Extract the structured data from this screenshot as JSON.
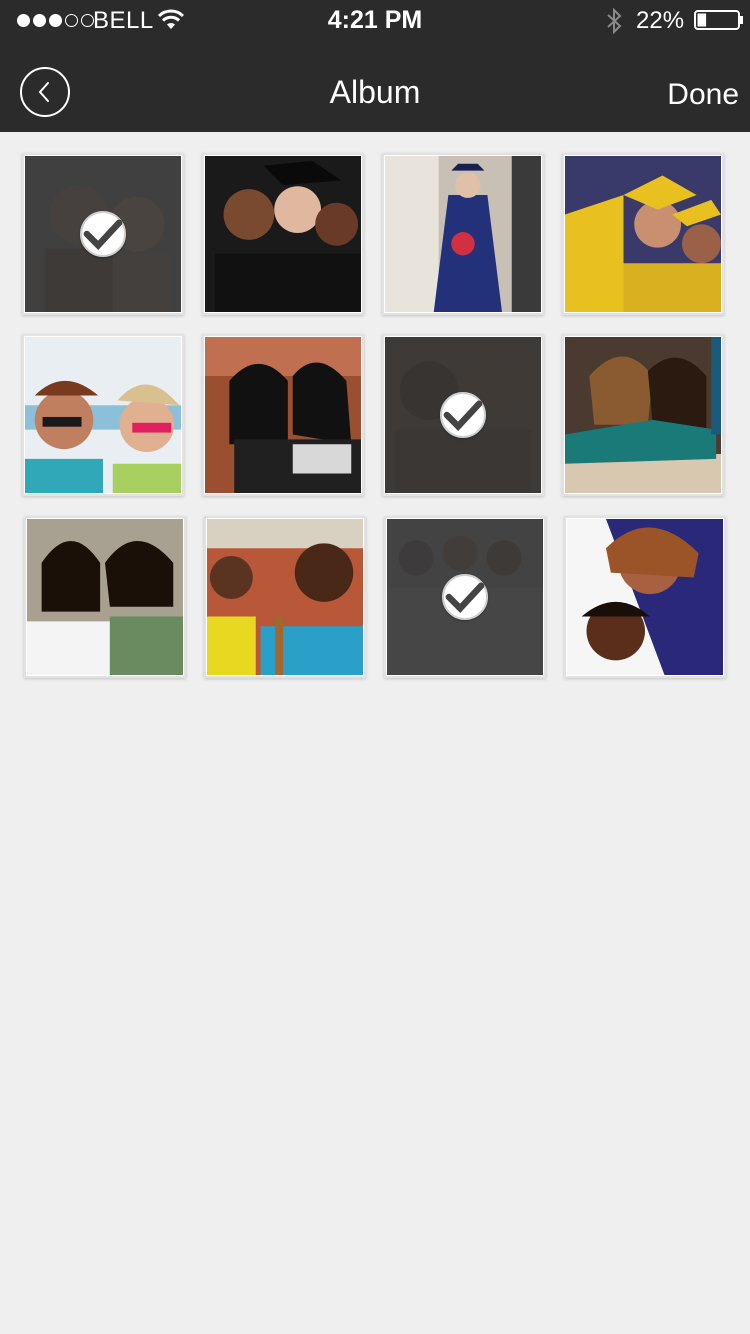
{
  "status_bar": {
    "carrier": "BELL",
    "time": "4:21 PM",
    "battery_percent": "22%",
    "battery_level": 0.22,
    "signal_strength": 3,
    "signal_max": 5,
    "icons": [
      "wifi-icon",
      "bluetooth-icon",
      "battery-icon"
    ]
  },
  "navbar": {
    "title": "Album",
    "back_icon": "chevron-left-icon",
    "done_label": "Done"
  },
  "colors": {
    "header_bg": "#2b2b2b",
    "page_bg": "#efefef",
    "selected_overlay": "#373737"
  },
  "photos": [
    {
      "subject": "two students",
      "selected": true
    },
    {
      "subject": "three graduates selfie",
      "selected": false
    },
    {
      "subject": "graduate with flowers",
      "selected": false
    },
    {
      "subject": "graduates in gold gowns",
      "selected": false
    },
    {
      "subject": "two girls with sunglasses",
      "selected": false
    },
    {
      "subject": "two students in lecture",
      "selected": false
    },
    {
      "subject": "friends with sunglasses",
      "selected": true
    },
    {
      "subject": "two girls on sofa",
      "selected": false
    },
    {
      "subject": "two smiling girls",
      "selected": false
    },
    {
      "subject": "two smiling guys",
      "selected": false
    },
    {
      "subject": "group of students",
      "selected": true
    },
    {
      "subject": "couple hugging",
      "selected": false
    }
  ]
}
